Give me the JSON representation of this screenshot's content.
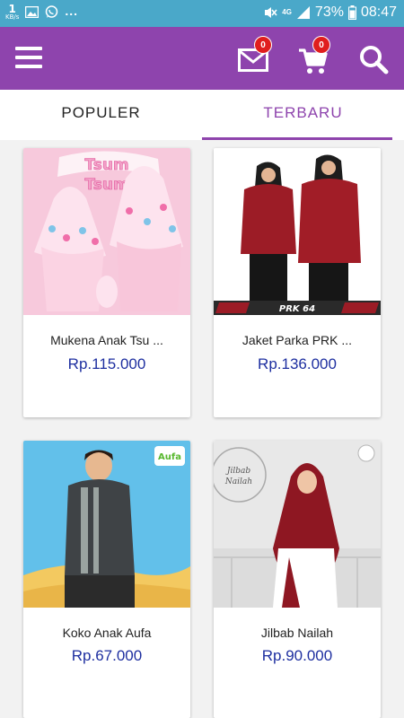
{
  "status_bar": {
    "speed_value": "1",
    "speed_unit": "KB/s",
    "overflow_dots": "...",
    "network": "4G",
    "battery": "73%",
    "time": "08:47",
    "background": "#4aa8c9"
  },
  "app_bar": {
    "background": "#8e44ad",
    "mail_badge": "0",
    "cart_badge": "0",
    "icons": [
      "menu-icon",
      "mail-icon",
      "cart-icon",
      "search-icon"
    ]
  },
  "tabs": [
    {
      "label": "POPULER",
      "active": false
    },
    {
      "label": "TERBARU",
      "active": true
    }
  ],
  "products": [
    {
      "name": "Mukena Anak Tsu ...",
      "price": "Rp.115.000",
      "image_text": "Tsum Tsum"
    },
    {
      "name": "Jaket Parka PRK ...",
      "price": "Rp.136.000",
      "image_text": "PRK 64"
    },
    {
      "name": "Koko Anak Aufa",
      "price": "Rp.67.000",
      "image_text": "Aufa"
    },
    {
      "name": "Jilbab Nailah",
      "price": "Rp.90.000",
      "image_text": "Jilbab Nailah"
    }
  ],
  "colors": {
    "accent": "#8e44ad",
    "price": "#1e2fa0",
    "badge": "#e01e1e"
  }
}
